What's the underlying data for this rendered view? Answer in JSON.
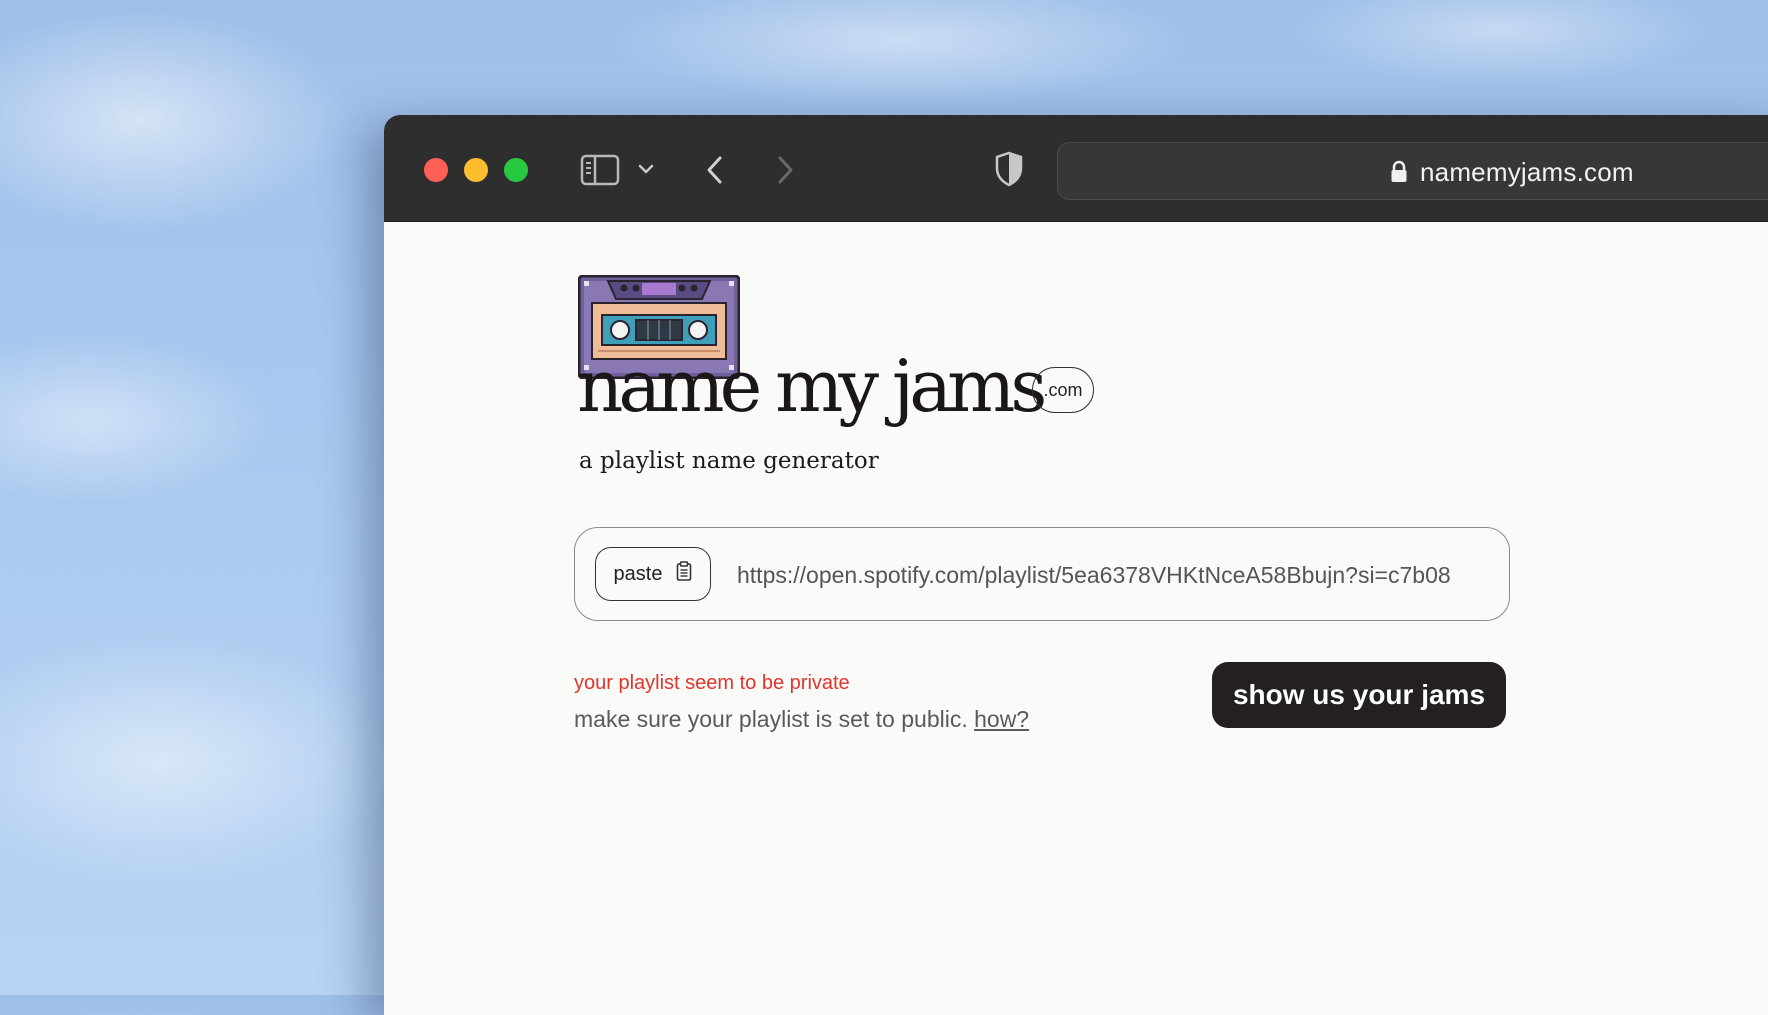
{
  "browser": {
    "url": "namemyjams.com",
    "colors": {
      "close": "#fe5f57",
      "minimize": "#febc2e",
      "maximize": "#28c840",
      "toolbar": "#2e2e2e"
    },
    "icons": [
      "sidebar-icon",
      "chevron-down-icon",
      "back-icon",
      "forward-icon",
      "shield-icon",
      "lock-icon"
    ]
  },
  "page": {
    "logo_icon": "cassette-tape-icon",
    "title": "name my jams",
    "tld_badge": ".com",
    "subtitle": "a playlist name generator",
    "paste_label": "paste",
    "paste_icon": "clipboard-icon",
    "playlist_url": "https://open.spotify.com/playlist/5ea6378VHKtNceA58Bbujn?si=c7b08",
    "error_text": "your playlist seem to be private",
    "hint_text": "make sure your playlist is set to public.",
    "hint_link": "how?",
    "submit_label": "show us your jams",
    "colors": {
      "error": "#e0352b",
      "button_bg": "#241f20",
      "background": "#fafaf9"
    }
  }
}
